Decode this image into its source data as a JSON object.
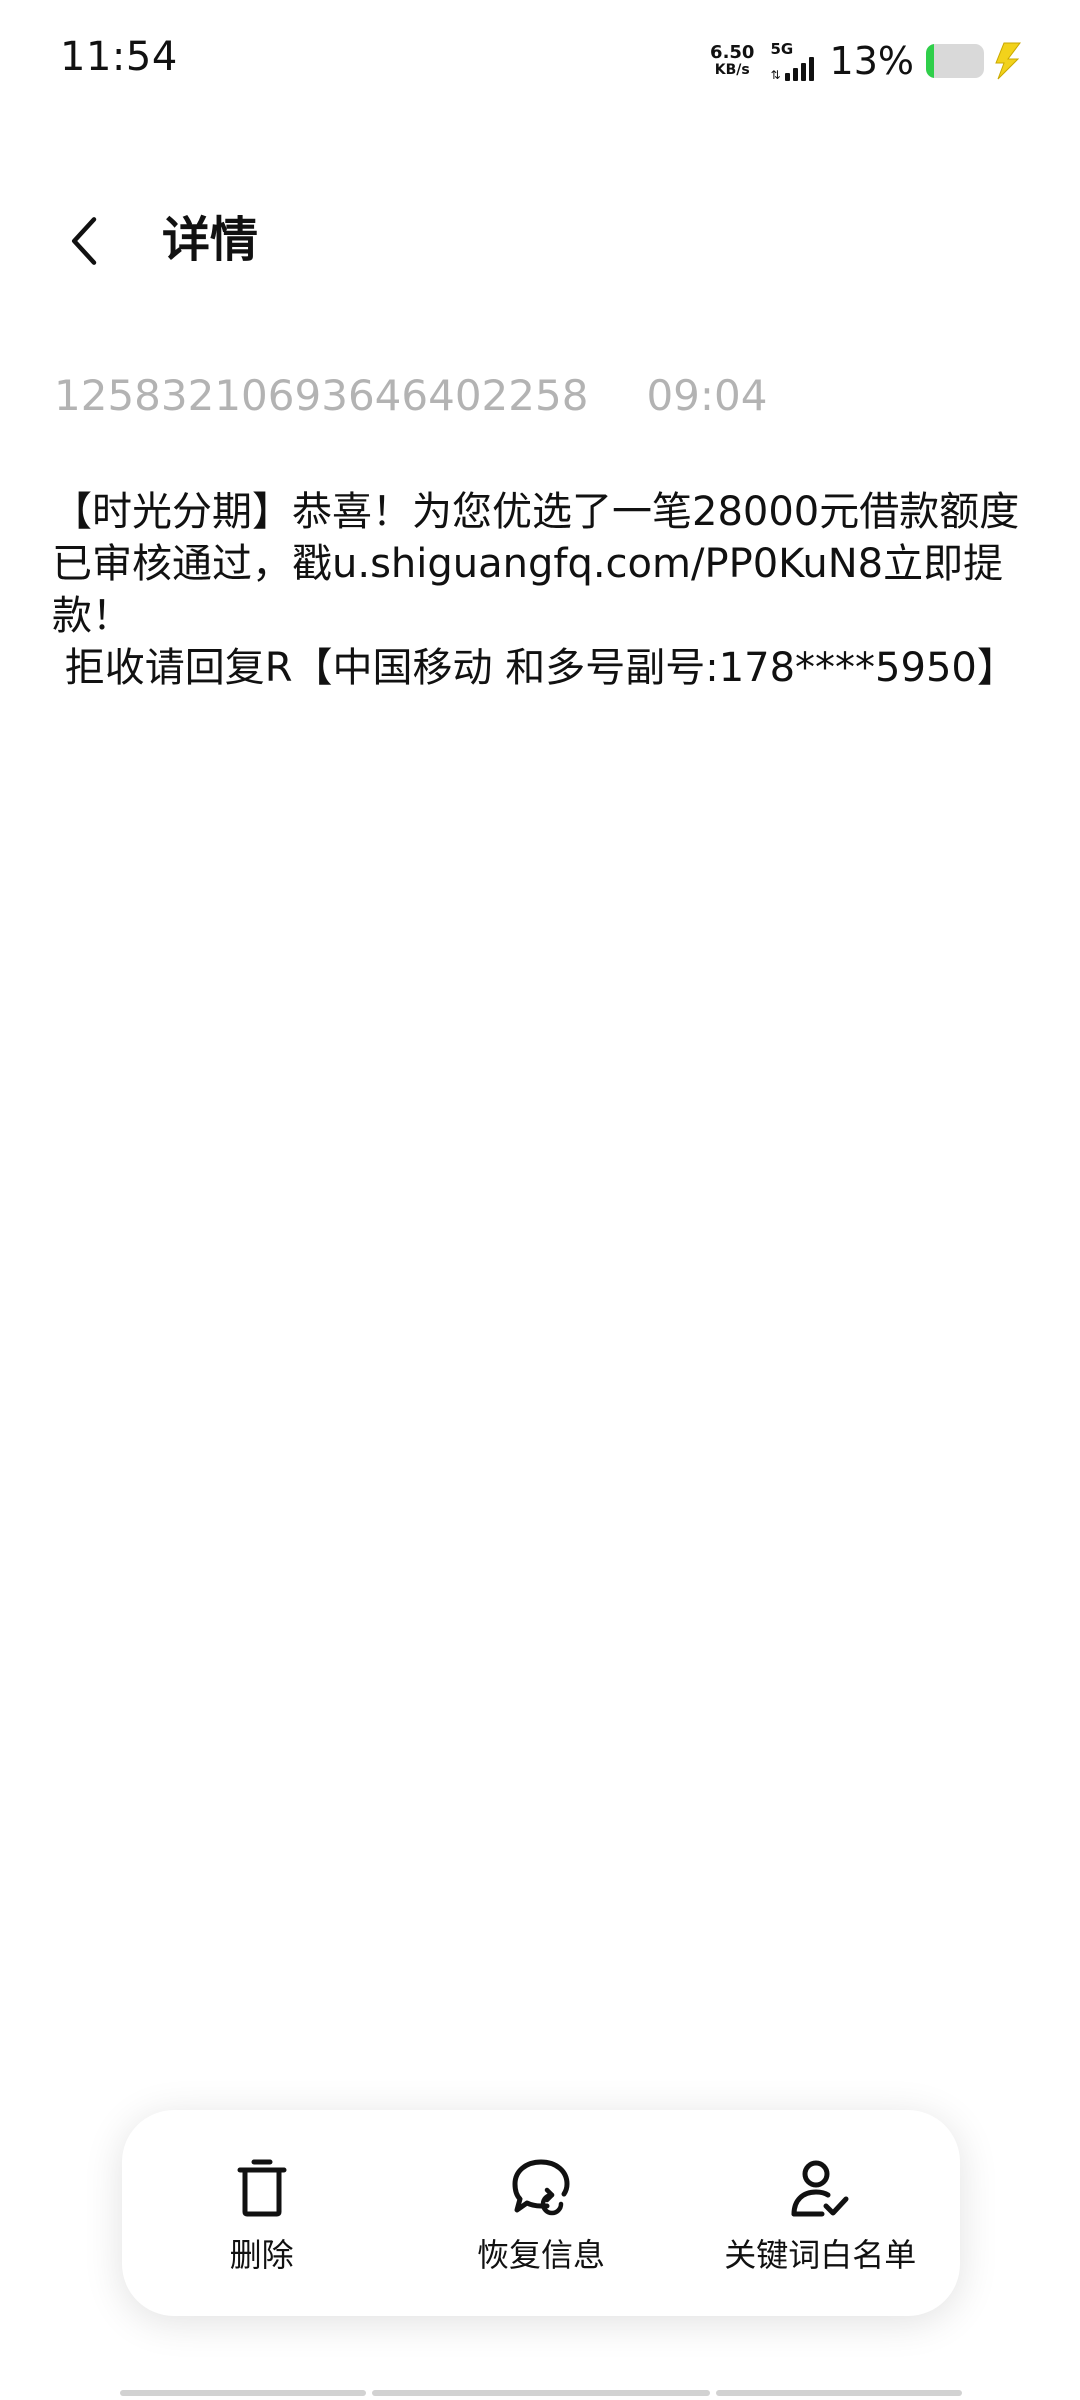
{
  "status_bar": {
    "time": "11:54",
    "net_speed_value": "6.50",
    "net_speed_unit": "KB/s",
    "network_type": "5G",
    "battery_percent": "13%",
    "battery_level": 0.13,
    "battery_color": "#2fcf4a",
    "charging_icon": "bolt-icon"
  },
  "header": {
    "title": "详情",
    "back_icon": "chevron-left-icon"
  },
  "message": {
    "sender": "1258321069364640225​8",
    "time": "09:04",
    "body": "【时光分期】恭喜！为您优选了一笔28000元借款额度已审核通过，戳u.shiguangfq.com/PP0KuN8立即提款！\n 拒收请回复R【中国移动 和多号副号:178****5950】"
  },
  "actions": [
    {
      "label": "删除",
      "icon": "trash-icon"
    },
    {
      "label": "恢复信息",
      "icon": "restore-message-icon"
    },
    {
      "label": "关键词白名单",
      "icon": "user-check-icon"
    }
  ]
}
